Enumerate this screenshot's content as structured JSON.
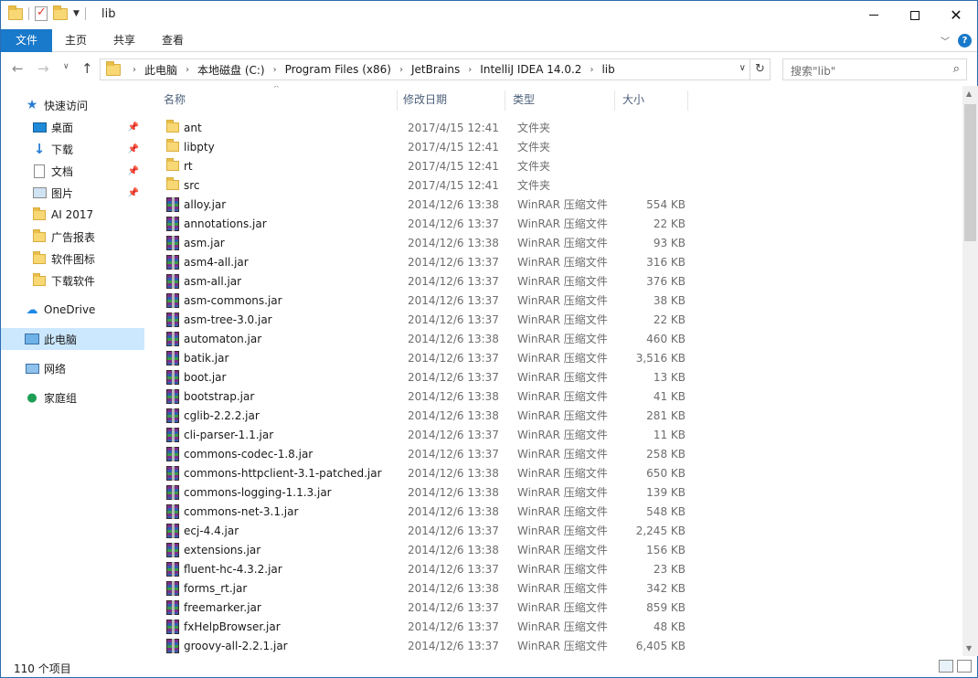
{
  "window": {
    "title": "lib"
  },
  "ribbon": {
    "tabs": [
      "文件",
      "主页",
      "共享",
      "查看"
    ]
  },
  "address": {
    "crumbs": [
      "此电脑",
      "本地磁盘 (C:)",
      "Program Files (x86)",
      "JetBrains",
      "IntelliJ IDEA 14.0.2",
      "lib"
    ]
  },
  "search": {
    "placeholder": "搜索\"lib\""
  },
  "nav": {
    "quick_access": "快速访问",
    "items": [
      {
        "label": "桌面",
        "icon": "desktop-icon",
        "pinned": true
      },
      {
        "label": "下载",
        "icon": "download-icon",
        "pinned": true
      },
      {
        "label": "文档",
        "icon": "document-icon",
        "pinned": true
      },
      {
        "label": "图片",
        "icon": "picture-icon",
        "pinned": true
      },
      {
        "label": "AI 2017",
        "icon": "folder-icon",
        "pinned": false
      },
      {
        "label": "广告报表",
        "icon": "folder-icon",
        "pinned": false
      },
      {
        "label": "软件图标",
        "icon": "folder-icon",
        "pinned": false
      },
      {
        "label": "下载软件",
        "icon": "folder-icon",
        "pinned": false
      }
    ],
    "onedrive": "OneDrive",
    "this_pc": "此电脑",
    "network": "网络",
    "homegroup": "家庭组"
  },
  "columns": {
    "name": "名称",
    "date": "修改日期",
    "type": "类型",
    "size": "大小"
  },
  "files": [
    {
      "name": "ant",
      "date": "2017/4/15 12:41",
      "type": "文件夹",
      "size": "",
      "kind": "folder"
    },
    {
      "name": "libpty",
      "date": "2017/4/15 12:41",
      "type": "文件夹",
      "size": "",
      "kind": "folder"
    },
    {
      "name": "rt",
      "date": "2017/4/15 12:41",
      "type": "文件夹",
      "size": "",
      "kind": "folder"
    },
    {
      "name": "src",
      "date": "2017/4/15 12:41",
      "type": "文件夹",
      "size": "",
      "kind": "folder"
    },
    {
      "name": "alloy.jar",
      "date": "2014/12/6 13:38",
      "type": "WinRAR 压缩文件",
      "size": "554 KB",
      "kind": "jar"
    },
    {
      "name": "annotations.jar",
      "date": "2014/12/6 13:37",
      "type": "WinRAR 压缩文件",
      "size": "22 KB",
      "kind": "jar"
    },
    {
      "name": "asm.jar",
      "date": "2014/12/6 13:38",
      "type": "WinRAR 压缩文件",
      "size": "93 KB",
      "kind": "jar"
    },
    {
      "name": "asm4-all.jar",
      "date": "2014/12/6 13:37",
      "type": "WinRAR 压缩文件",
      "size": "316 KB",
      "kind": "jar"
    },
    {
      "name": "asm-all.jar",
      "date": "2014/12/6 13:37",
      "type": "WinRAR 压缩文件",
      "size": "376 KB",
      "kind": "jar"
    },
    {
      "name": "asm-commons.jar",
      "date": "2014/12/6 13:37",
      "type": "WinRAR 压缩文件",
      "size": "38 KB",
      "kind": "jar"
    },
    {
      "name": "asm-tree-3.0.jar",
      "date": "2014/12/6 13:37",
      "type": "WinRAR 压缩文件",
      "size": "22 KB",
      "kind": "jar"
    },
    {
      "name": "automaton.jar",
      "date": "2014/12/6 13:38",
      "type": "WinRAR 压缩文件",
      "size": "460 KB",
      "kind": "jar"
    },
    {
      "name": "batik.jar",
      "date": "2014/12/6 13:37",
      "type": "WinRAR 压缩文件",
      "size": "3,516 KB",
      "kind": "jar"
    },
    {
      "name": "boot.jar",
      "date": "2014/12/6 13:37",
      "type": "WinRAR 压缩文件",
      "size": "13 KB",
      "kind": "jar"
    },
    {
      "name": "bootstrap.jar",
      "date": "2014/12/6 13:38",
      "type": "WinRAR 压缩文件",
      "size": "41 KB",
      "kind": "jar"
    },
    {
      "name": "cglib-2.2.2.jar",
      "date": "2014/12/6 13:38",
      "type": "WinRAR 压缩文件",
      "size": "281 KB",
      "kind": "jar"
    },
    {
      "name": "cli-parser-1.1.jar",
      "date": "2014/12/6 13:37",
      "type": "WinRAR 压缩文件",
      "size": "11 KB",
      "kind": "jar"
    },
    {
      "name": "commons-codec-1.8.jar",
      "date": "2014/12/6 13:37",
      "type": "WinRAR 压缩文件",
      "size": "258 KB",
      "kind": "jar"
    },
    {
      "name": "commons-httpclient-3.1-patched.jar",
      "date": "2014/12/6 13:38",
      "type": "WinRAR 压缩文件",
      "size": "650 KB",
      "kind": "jar"
    },
    {
      "name": "commons-logging-1.1.3.jar",
      "date": "2014/12/6 13:38",
      "type": "WinRAR 压缩文件",
      "size": "139 KB",
      "kind": "jar"
    },
    {
      "name": "commons-net-3.1.jar",
      "date": "2014/12/6 13:38",
      "type": "WinRAR 压缩文件",
      "size": "548 KB",
      "kind": "jar"
    },
    {
      "name": "ecj-4.4.jar",
      "date": "2014/12/6 13:37",
      "type": "WinRAR 压缩文件",
      "size": "2,245 KB",
      "kind": "jar"
    },
    {
      "name": "extensions.jar",
      "date": "2014/12/6 13:38",
      "type": "WinRAR 压缩文件",
      "size": "156 KB",
      "kind": "jar"
    },
    {
      "name": "fluent-hc-4.3.2.jar",
      "date": "2014/12/6 13:37",
      "type": "WinRAR 压缩文件",
      "size": "23 KB",
      "kind": "jar"
    },
    {
      "name": "forms_rt.jar",
      "date": "2014/12/6 13:38",
      "type": "WinRAR 压缩文件",
      "size": "342 KB",
      "kind": "jar"
    },
    {
      "name": "freemarker.jar",
      "date": "2014/12/6 13:37",
      "type": "WinRAR 压缩文件",
      "size": "859 KB",
      "kind": "jar"
    },
    {
      "name": "fxHelpBrowser.jar",
      "date": "2014/12/6 13:37",
      "type": "WinRAR 压缩文件",
      "size": "48 KB",
      "kind": "jar"
    },
    {
      "name": "groovy-all-2.2.1.jar",
      "date": "2014/12/6 13:37",
      "type": "WinRAR 压缩文件",
      "size": "6,405 KB",
      "kind": "jar"
    }
  ],
  "status": {
    "count": "110 个项目"
  },
  "colors": {
    "accent": "#1979ca",
    "selection": "#cce8ff",
    "muted_text": "#6d6d6d"
  }
}
